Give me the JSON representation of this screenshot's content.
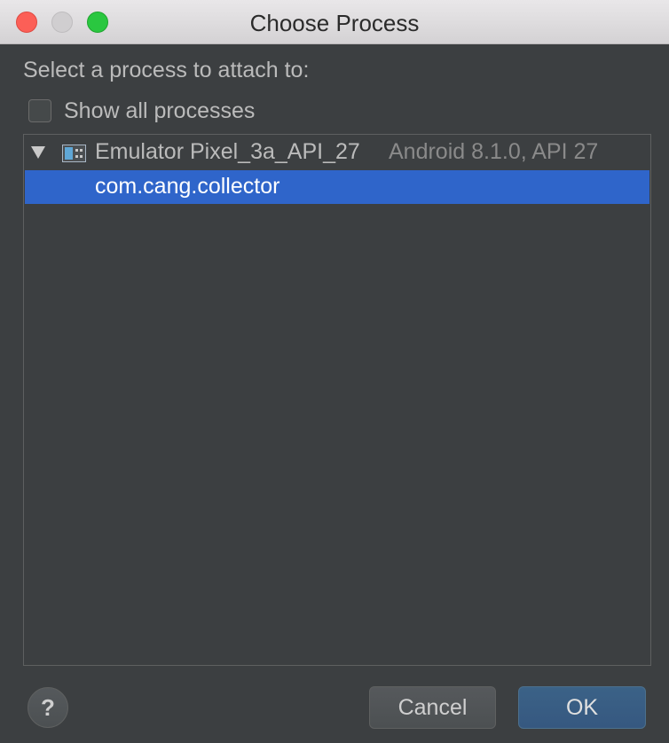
{
  "window": {
    "title": "Choose Process"
  },
  "prompt": "Select a process to attach to:",
  "show_all": {
    "label": "Show all processes",
    "checked": false
  },
  "tree": {
    "device": {
      "name": "Emulator Pixel_3a_API_27",
      "meta": "Android 8.1.0, API 27",
      "icon": "emulator-device-icon",
      "expanded": true
    },
    "processes": [
      {
        "name": "com.cang.collector",
        "selected": true
      }
    ]
  },
  "buttons": {
    "help": "?",
    "cancel": "Cancel",
    "ok": "OK"
  },
  "colors": {
    "background": "#3c3f41",
    "selection": "#2f65ca",
    "default_button": "#365880"
  }
}
